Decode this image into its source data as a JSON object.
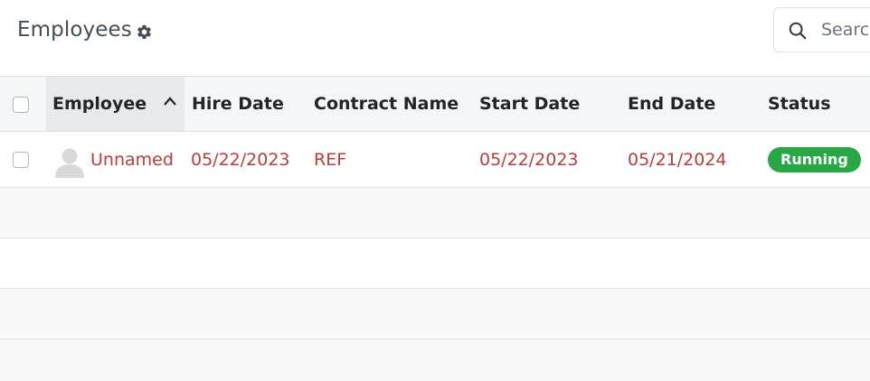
{
  "header": {
    "title": "Employees",
    "settings_icon": "gear-icon",
    "search": {
      "placeholder": "Search",
      "icon": "search-icon"
    }
  },
  "table": {
    "columns": [
      "Employee",
      "Hire Date",
      "Contract Name",
      "Start Date",
      "End Date",
      "Status"
    ],
    "sort": {
      "column": "Employee",
      "direction": "ascending"
    },
    "rows": [
      {
        "employee": "Unnamed",
        "hire_date": "05/22/2023",
        "contract_name": "REF",
        "start_date": "05/22/2023",
        "end_date": "05/21/2024",
        "status": "Running",
        "status_color": "#28a745"
      }
    ]
  },
  "colors": {
    "link_red": "#c03b3b",
    "header_bg": "#f5f6f8",
    "running_green": "#28a745"
  }
}
